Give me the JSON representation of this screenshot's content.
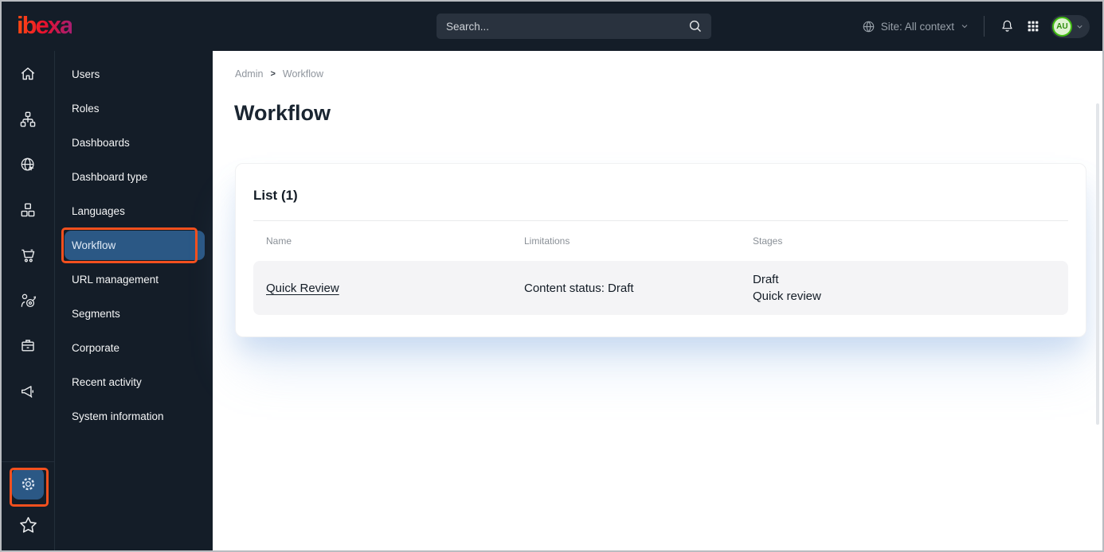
{
  "topbar": {
    "logo_text": "ibexa",
    "search": {
      "placeholder": "Search..."
    },
    "site_context_label": "Site: All context",
    "avatar_initials": "AU"
  },
  "sidebar": {
    "rail_icons": [
      "home",
      "content-tree",
      "site",
      "products",
      "commerce",
      "personalization",
      "customers",
      "marketing"
    ],
    "menu_items": [
      "Users",
      "Roles",
      "Dashboards",
      "Dashboard type",
      "Languages",
      "Workflow",
      "URL management",
      "Segments",
      "Corporate",
      "Recent activity",
      "System information"
    ],
    "selected_item": "Workflow",
    "bottom_icons": [
      "settings",
      "favorites"
    ]
  },
  "main": {
    "breadcrumb": {
      "items": [
        "Admin",
        "Workflow"
      ],
      "separator": ">"
    },
    "page_title": "Workflow",
    "list_card": {
      "title": "List (1)",
      "columns": [
        "Name",
        "Limitations",
        "Stages"
      ],
      "rows": [
        {
          "name": "Quick Review",
          "limitations": "Content status: Draft",
          "stages": [
            "Draft",
            "Quick review"
          ]
        }
      ]
    }
  },
  "colors": {
    "topbar_bg": "#141d28",
    "selected_blue": "#2b5885",
    "annotation_orange": "#f4501e",
    "avatar_ring_green": "#43bd13",
    "logo_gradient_start": "#ff4713",
    "logo_gradient_end": "#aa1d6e",
    "row_bg": "#f4f4f6"
  }
}
